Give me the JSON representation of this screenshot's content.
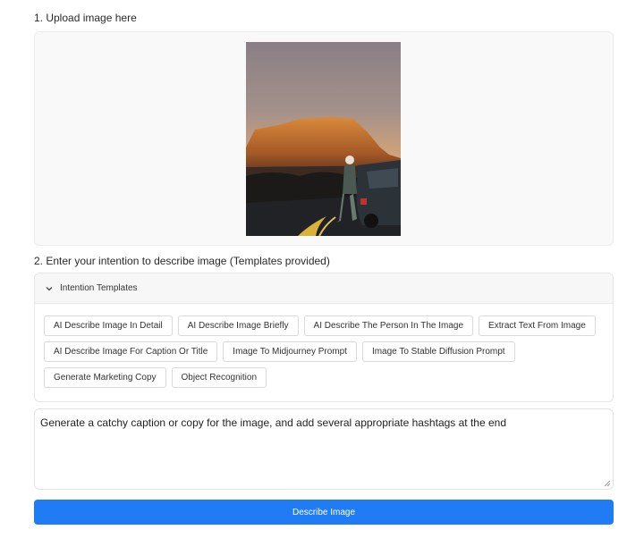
{
  "upload": {
    "label": "1. Upload image here"
  },
  "intention": {
    "label": "2. Enter your intention to describe image (Templates provided)",
    "templates_title": "Intention Templates",
    "templates_expanded": true,
    "chips": [
      [
        "AI Describe Image In Detail",
        "AI Describe Image Briefly",
        "AI Describe The Person In The Image",
        "Extract Text From Image"
      ],
      [
        "AI Describe Image For Caption Or Title",
        "Image To Midjourney Prompt",
        "Image To Stable Diffusion Prompt"
      ],
      [
        "Generate Marketing Copy",
        "Object Recognition"
      ]
    ],
    "prompt_value": "Generate a catchy caption or copy for the image, and add several appropriate hashtags at the end"
  },
  "actions": {
    "describe_label": "Describe Image"
  },
  "colors": {
    "accent": "#1f7cf5"
  },
  "icons": {
    "templates_toggle": "chevron-down-icon",
    "resize": "resize-grip-icon"
  }
}
